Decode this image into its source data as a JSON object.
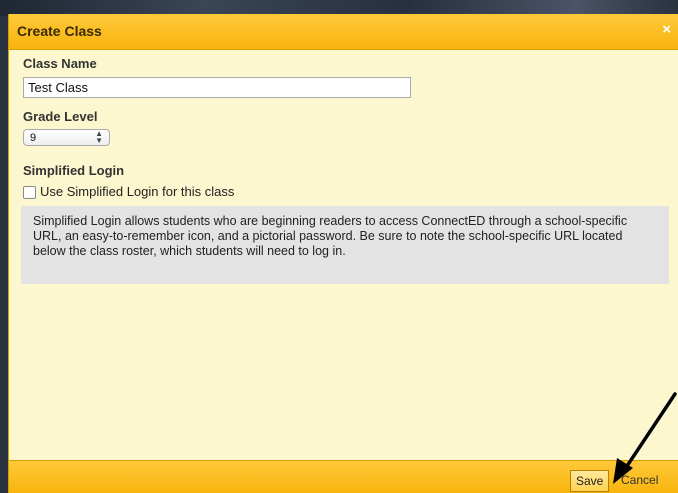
{
  "dialog": {
    "title": "Create Class",
    "close_glyph": "×"
  },
  "form": {
    "class_name_label": "Class Name",
    "class_name_value": "Test Class",
    "grade_level_label": "Grade Level",
    "grade_level_value": "9",
    "simplified_login_label": "Simplified Login",
    "simplified_login_checkbox_label": "Use Simplified Login for this class",
    "simplified_login_checked": false,
    "info_text": "Simplified Login allows students who are beginning readers to access ConnectED through a school-specific URL, an easy-to-remember icon, and a pictorial password. Be sure to note the school-specific URL located below the class roster, which students will need to log in."
  },
  "footer": {
    "save_label": "Save",
    "cancel_label": "Cancel"
  },
  "colors": {
    "header_bar": "#f8b40e",
    "dialog_background": "#fdf7cf",
    "info_background": "#e3e3e3"
  },
  "icons": {
    "close": "close-icon",
    "select_arrows": "up-down-arrows-icon",
    "annotation_arrow": "pointer-arrow-icon"
  }
}
